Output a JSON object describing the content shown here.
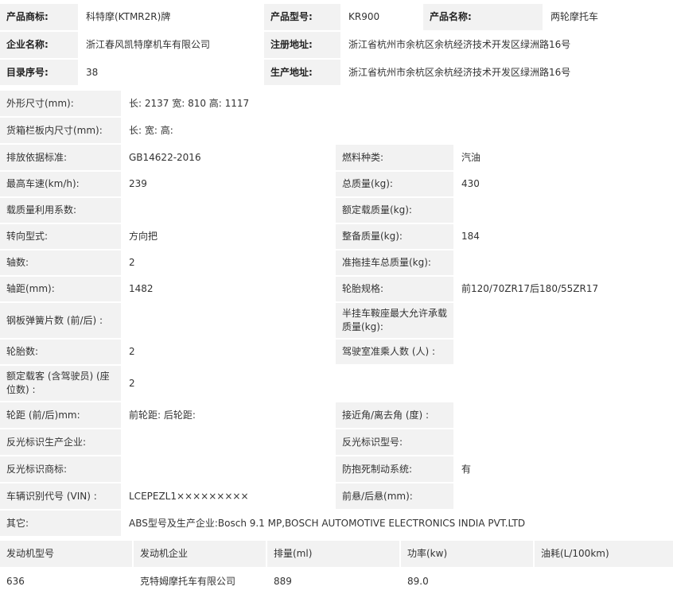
{
  "header": {
    "brand_label": "产品商标:",
    "brand_value": "科特摩(KTMR2R)牌",
    "model_label": "产品型号:",
    "model_value": "KR900",
    "name_label": "产品名称:",
    "name_value": "两轮摩托车",
    "company_label": "企业名称:",
    "company_value": "浙江春风凯特摩机车有限公司",
    "regaddr_label": "注册地址:",
    "regaddr_value": "浙江省杭州市余杭区余杭经济技术开发区绿洲路16号",
    "catalog_label": "目录序号:",
    "catalog_value": "38",
    "prodaddr_label": "生产地址:",
    "prodaddr_value": "浙江省杭州市余杭区余杭经济技术开发区绿洲路16号"
  },
  "specs": {
    "dimensions_label": "外形尺寸(mm):",
    "dimensions_value": "长: 2137 宽: 810 高: 1117",
    "cargo_label": "货箱栏板内尺寸(mm):",
    "cargo_value": "长: 宽: 高:",
    "emission_label": "排放依据标准:",
    "emission_value": "GB14622-2016",
    "fuel_label": "燃料种类:",
    "fuel_value": "汽油",
    "maxspeed_label": "最高车速(km/h):",
    "maxspeed_value": "239",
    "totalmass_label": "总质量(kg):",
    "totalmass_value": "430",
    "loadutil_label": "载质量利用系数:",
    "loadutil_value": "",
    "ratedload_label": "额定载质量(kg):",
    "ratedload_value": "",
    "steering_label": "转向型式:",
    "steering_value": "方向把",
    "curbmass_label": "整备质量(kg):",
    "curbmass_value": "184",
    "axles_label": "轴数:",
    "axles_value": "2",
    "trailer_label": "准拖挂车总质量(kg):",
    "trailer_value": "",
    "wheelbase_label": "轴距(mm):",
    "wheelbase_value": "1482",
    "tire_label": "轮胎规格:",
    "tire_value": "前120/70ZR17后180/55ZR17",
    "spring_label": "钢板弹簧片数 (前/后) :",
    "spring_value": "",
    "saddle_label": "半挂车鞍座最大允许承载质量(kg):",
    "saddle_value": "",
    "tirecount_label": "轮胎数:",
    "tirecount_value": "2",
    "cab_label": "驾驶室准乘人数 (人) :",
    "cab_value": "",
    "seats_label": "额定载客 (含驾驶员) (座位数) :",
    "seats_value": "2",
    "track_label": "轮距 (前/后)mm:",
    "track_value": "前轮距: 后轮距:",
    "angle_label": "接近角/离去角 (度) :",
    "angle_value": "",
    "reflector_maker_label": "反光标识生产企业:",
    "reflector_maker_value": "",
    "reflector_model_label": "反光标识型号:",
    "reflector_model_value": "",
    "reflector_brand_label": "反光标识商标:",
    "reflector_brand_value": "",
    "abs_label": "防抱死制动系统:",
    "abs_value": "有",
    "vin_label": "车辆识别代号 (VIN) :",
    "vin_value": "LCEPEZL1×××××××××",
    "overhang_label": "前悬/后悬(mm):",
    "overhang_value": "",
    "other_label": "其它:",
    "other_value": "ABS型号及生产企业:Bosch 9.1 MP,BOSCH AUTOMOTIVE ELECTRONICS INDIA PVT.LTD"
  },
  "engine": {
    "headers": [
      "发动机型号",
      "发动机企业",
      "排量(ml)",
      "功率(kw)",
      "油耗(L/100km)"
    ],
    "row": [
      "636",
      "克特姆摩托车有限公司",
      "889",
      "89.0",
      ""
    ]
  }
}
